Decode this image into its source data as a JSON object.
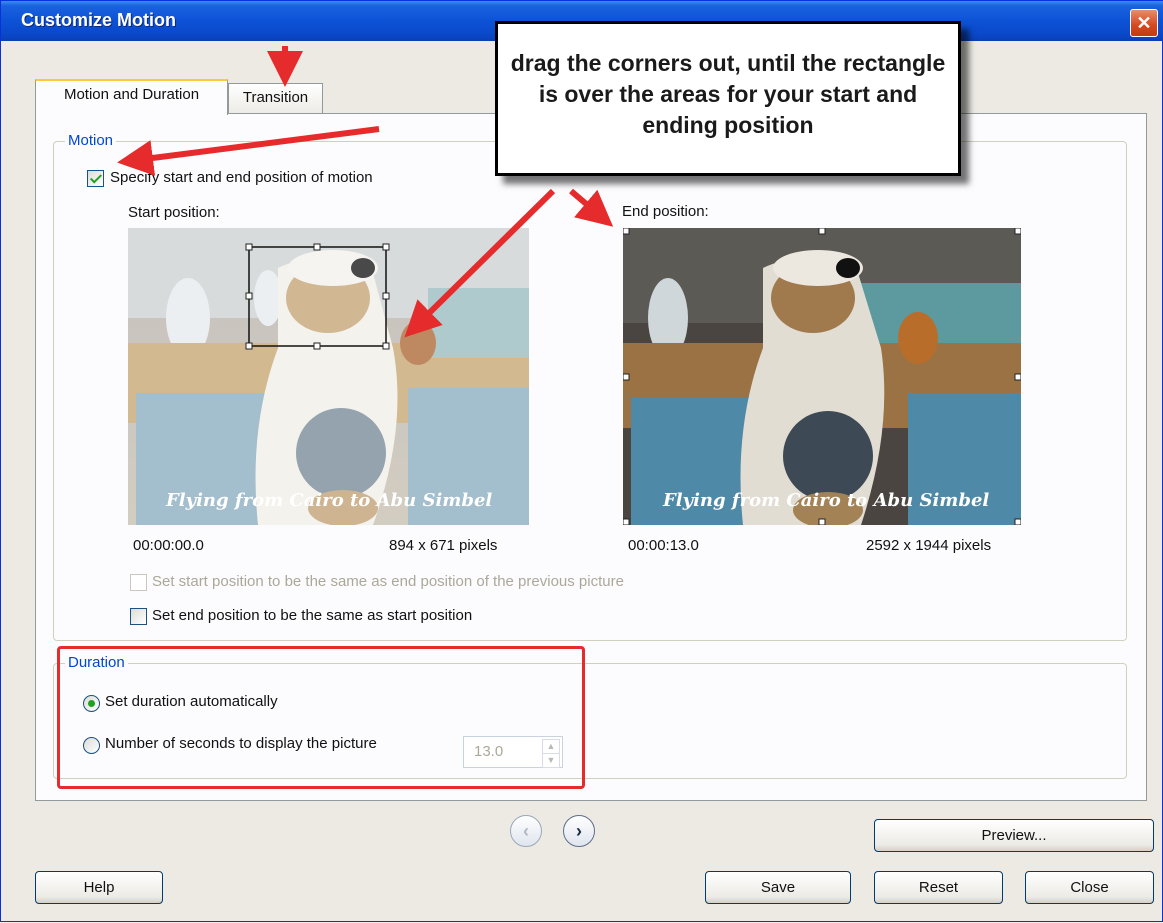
{
  "window": {
    "title": "Customize Motion",
    "close_glyph": "✕"
  },
  "tabs": [
    {
      "label": "Motion and Duration",
      "active": true
    },
    {
      "label": "Transition",
      "active": false
    }
  ],
  "motion": {
    "legend": "Motion",
    "specify_label": "Specify start and end position of motion",
    "specify_checked": true,
    "start_label": "Start position:",
    "end_label": "End position:",
    "start_time": "00:00:00.0",
    "start_size": "894 x 671 pixels",
    "end_time": "00:00:13.0",
    "end_size": "2592 x 1944 pixels",
    "photo_caption": "Flying from Cairo to Abu Simbel",
    "same_as_prev_label": "Set start position to be the same as end position of the previous picture",
    "same_as_start_label": "Set end position to be the same as start position"
  },
  "duration": {
    "legend": "Duration",
    "auto_label": "Set duration automatically",
    "seconds_label": "Number of seconds to display the picture",
    "seconds_value": "13.0"
  },
  "buttons": {
    "preview": "Preview...",
    "help": "Help",
    "save": "Save",
    "reset": "Reset",
    "close": "Close",
    "prev_glyph": "‹",
    "next_glyph": "›"
  },
  "annotation": {
    "callout_text": "drag the corners out, until the rectangle is over the areas for your start and ending position"
  },
  "colors": {
    "titlebar": "#0a48c9",
    "legend": "#0046d5",
    "annotation_red": "#e52b2b"
  }
}
